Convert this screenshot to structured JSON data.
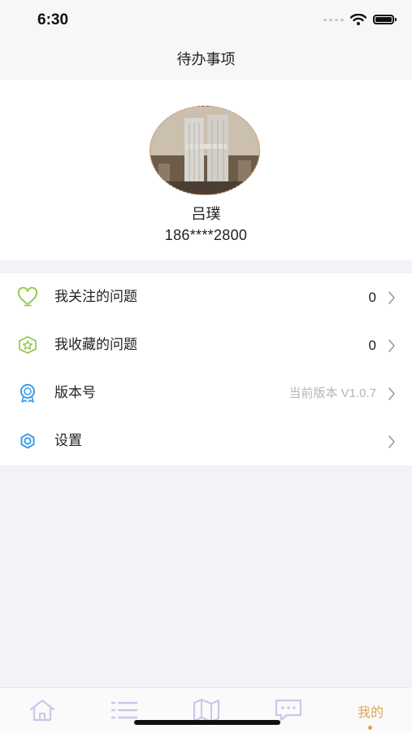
{
  "status_bar": {
    "time": "6:30"
  },
  "header": {
    "title": "待办事项"
  },
  "profile": {
    "name": "吕璞",
    "phone": "186****2800"
  },
  "menu": [
    {
      "label": "我关注的问题",
      "value": "0",
      "icon": "heart-icon"
    },
    {
      "label": "我收藏的问题",
      "value": "0",
      "icon": "star-badge-icon"
    },
    {
      "label": "版本号",
      "value": "当前版本 V1.0.7",
      "icon": "award-ribbon-icon"
    },
    {
      "label": "设置",
      "value": "",
      "icon": "gear-icon"
    }
  ],
  "tab_bar": {
    "tabs": [
      {
        "icon": "home-icon"
      },
      {
        "icon": "list-icon"
      },
      {
        "icon": "map-icon"
      },
      {
        "icon": "chat-icon"
      },
      {
        "label": "我的"
      }
    ],
    "active_index": 4
  },
  "colors": {
    "accent": "#e0a64a",
    "icon_green": "#8cc63f",
    "icon_blue": "#3d9be9",
    "tab_inactive": "#c9c7ef"
  }
}
